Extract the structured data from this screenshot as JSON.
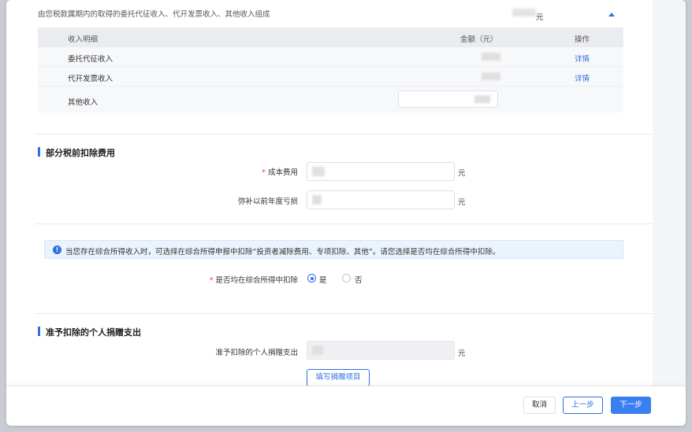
{
  "income": {
    "description": "由您税款属期内的取得的委托代征收入、代开发票收入、其他收入组成",
    "total_unit": "元",
    "table": {
      "headers": [
        "收入明细",
        "金额（元）",
        "操作"
      ],
      "rows": [
        {
          "name": "委托代征收入",
          "action": "详情"
        },
        {
          "name": "代开发票收入",
          "action": "详情"
        },
        {
          "name": "其他收入",
          "action": ""
        }
      ]
    }
  },
  "deductions": {
    "title": "部分税前扣除费用",
    "cost_required": "*",
    "cost_label": "成本费用",
    "cost_unit": "元",
    "loss_label": "弥补以前年度亏损",
    "loss_unit": "元"
  },
  "notice": {
    "icon": "info-icon",
    "icon_glyph": "!",
    "text": "当您存在综合所得收入时，可选择在综合所得申报中扣除“投资者减除费用、专项扣除、其他”。请您选择是否均在综合所得中扣除。"
  },
  "comprehensive": {
    "required": "*",
    "label": "是否均在综合所得中扣除",
    "options": [
      "是",
      "否"
    ],
    "selected": "是"
  },
  "donation": {
    "title": "准予扣除的个人捐赠支出",
    "label": "准予扣除的个人捐赠支出",
    "unit": "元",
    "fill_button": "填写捐赠项目"
  },
  "footer": {
    "cancel": "取消",
    "prev": "上一步",
    "next": "下一步"
  },
  "colors": {
    "accent": "#2f6fe0",
    "primary_button": "#3a7ff0",
    "required": "#e0453b",
    "notice_bg": "#ebf3fd"
  }
}
